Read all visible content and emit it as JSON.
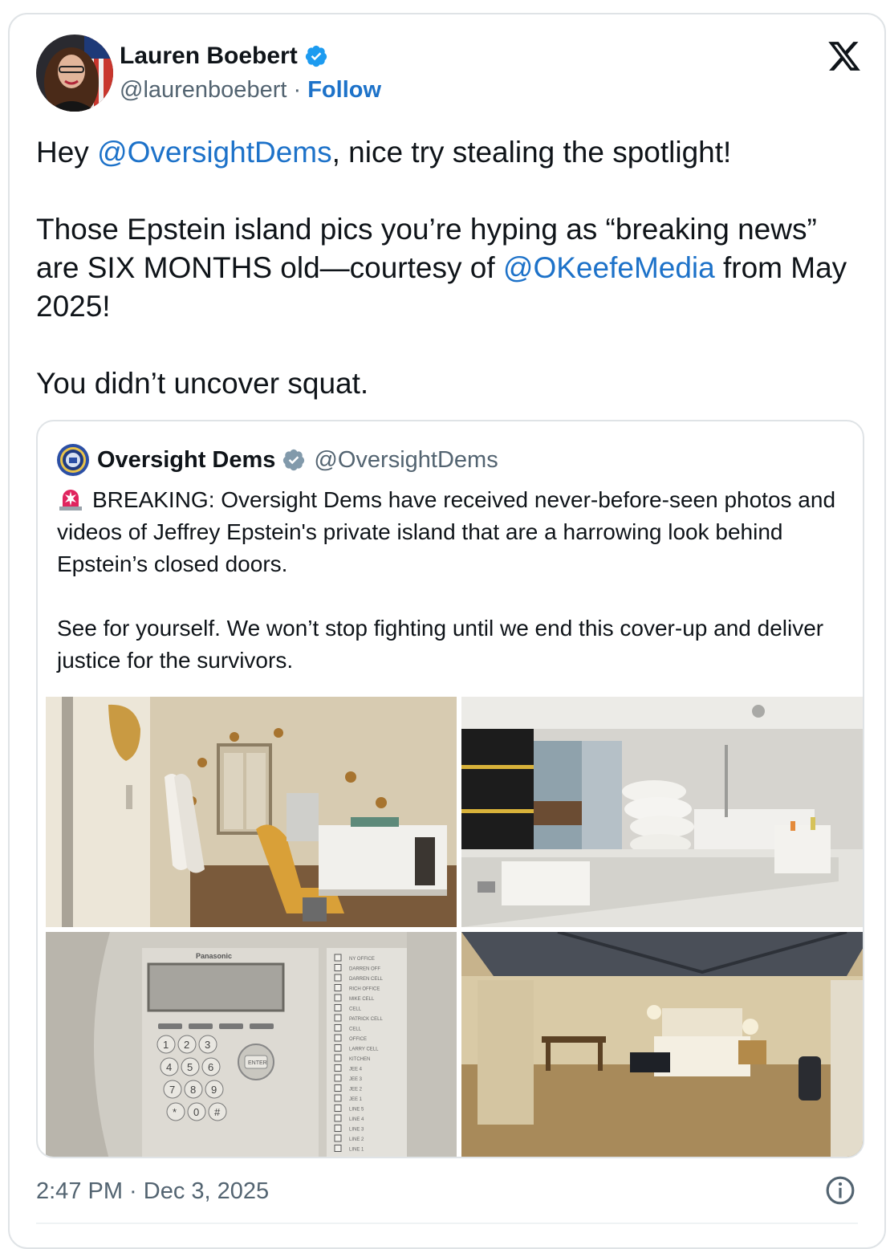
{
  "tweet": {
    "author": {
      "name": "Lauren Boebert",
      "handle": "@laurenboebert",
      "separator": " · ",
      "follow_label": "Follow"
    },
    "text": {
      "p1_pre": "Hey ",
      "p1_mention": "@OversightDems",
      "p1_post": ", nice try stealing the spotlight!",
      "p2_pre": "Those Epstein island pics you’re hyping as “breaking news” are SIX MONTHS old—courtesy of ",
      "p2_mention": "@OKeefeMedia",
      "p2_post": " from May 2025!",
      "p3": "You didn’t uncover squat."
    },
    "timestamp": "2:47 PM · Dec 3, 2025"
  },
  "quote": {
    "name": "Oversight Dems",
    "handle": "@OversightDems",
    "p1": "BREAKING: Oversight Dems have received never-before-seen photos and videos of Jeffrey Epstein's private island that are a harrowing look behind Epstein’s closed doors.",
    "p2": "See for yourself. We won’t stop fighting until we end this cover-up and deliver justice for the survivors."
  },
  "photos": {
    "phone_brand": "Panasonic",
    "phone_enter": "ENTER",
    "phone_lines": [
      "NY OFFICE",
      "DARREN OFF",
      "DARREN CELL",
      "RICH OFFICE",
      "MIKE CELL",
      "CELL",
      "PATRICK CELL",
      "CELL",
      "OFFICE",
      "LARRY CELL",
      "KITCHEN",
      "JEE 4",
      "JEE 3",
      "JEE 2",
      "JEE 1",
      "LINE 5",
      "LINE 4",
      "LINE 3",
      "LINE 2",
      "LINE 1"
    ],
    "keypad": [
      "1",
      "2",
      "3",
      "4",
      "5",
      "6",
      "7",
      "8",
      "9",
      "*",
      "0",
      "#"
    ]
  },
  "colors": {
    "link": "#1d72c9",
    "verified": "#1d9bf0",
    "muted": "#536471",
    "border": "#dfe3e6"
  },
  "icons": [
    "verified-badge-icon",
    "x-logo-icon",
    "siren-icon",
    "info-icon"
  ]
}
